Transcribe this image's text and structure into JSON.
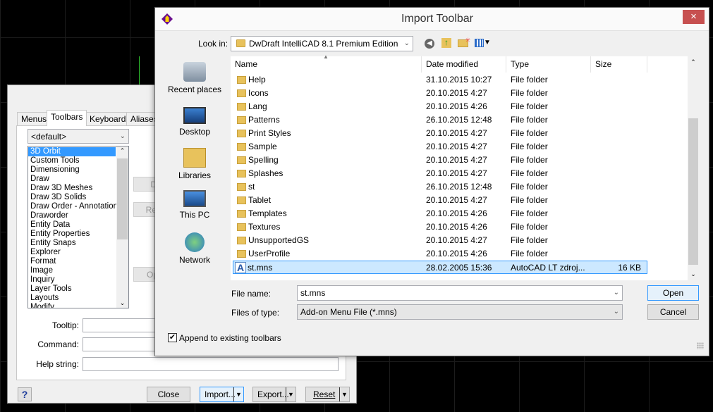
{
  "customize_dialog": {
    "tabs": [
      "Menus",
      "Toolbars",
      "Keyboard",
      "Aliases"
    ],
    "active_tab": "Toolbars",
    "toolbar_set": "<default>",
    "toolbars": [
      "3D Orbit",
      "Custom Tools",
      "Dimensioning",
      "Draw",
      "Draw 3D Meshes",
      "Draw 3D Solids",
      "Draw Order - Annotation",
      "Draworder",
      "Entity Data",
      "Entity Properties",
      "Entity Snaps",
      "Explorer",
      "Format",
      "Image",
      "Inquiry",
      "Layer Tools",
      "Layouts",
      "Modify"
    ],
    "selected_toolbar": "3D Orbit",
    "side_buttons": [
      "D",
      "Re",
      "Op"
    ],
    "tooltip_label": "Tooltip:",
    "command_label": "Command:",
    "help_label": "Help string:",
    "help_button": "?",
    "close_button": "Close",
    "import_button": "Import...",
    "export_button": "Export...",
    "reset_button": "Reset"
  },
  "import_dialog": {
    "title": "Import Toolbar",
    "close_icon": "×",
    "look_in_label": "Look in:",
    "look_in_value": "DwDraft IntelliCAD 8.1 Premium Edition",
    "places": [
      "Recent places",
      "Desktop",
      "Libraries",
      "This PC",
      "Network"
    ],
    "columns": [
      "Name",
      "Date modified",
      "Type",
      "Size"
    ],
    "files": [
      {
        "name": "Help",
        "date": "31.10.2015 10:27",
        "type": "File folder",
        "size": ""
      },
      {
        "name": "Icons",
        "date": "20.10.2015 4:27",
        "type": "File folder",
        "size": ""
      },
      {
        "name": "Lang",
        "date": "20.10.2015 4:26",
        "type": "File folder",
        "size": ""
      },
      {
        "name": "Patterns",
        "date": "26.10.2015 12:48",
        "type": "File folder",
        "size": ""
      },
      {
        "name": "Print Styles",
        "date": "20.10.2015 4:27",
        "type": "File folder",
        "size": ""
      },
      {
        "name": "Sample",
        "date": "20.10.2015 4:27",
        "type": "File folder",
        "size": ""
      },
      {
        "name": "Spelling",
        "date": "20.10.2015 4:27",
        "type": "File folder",
        "size": ""
      },
      {
        "name": "Splashes",
        "date": "20.10.2015 4:27",
        "type": "File folder",
        "size": ""
      },
      {
        "name": "st",
        "date": "26.10.2015 12:48",
        "type": "File folder",
        "size": ""
      },
      {
        "name": "Tablet",
        "date": "20.10.2015 4:27",
        "type": "File folder",
        "size": ""
      },
      {
        "name": "Templates",
        "date": "20.10.2015 4:26",
        "type": "File folder",
        "size": ""
      },
      {
        "name": "Textures",
        "date": "20.10.2015 4:26",
        "type": "File folder",
        "size": ""
      },
      {
        "name": "UnsupportedGS",
        "date": "20.10.2015 4:27",
        "type": "File folder",
        "size": ""
      },
      {
        "name": "UserProfile",
        "date": "20.10.2015 4:26",
        "type": "File folder",
        "size": ""
      },
      {
        "name": "st.mns",
        "date": "28.02.2005 15:36",
        "type": "AutoCAD LT zdroj...",
        "size": "16 KB"
      }
    ],
    "selected_file": "st.mns",
    "file_name_label": "File name:",
    "file_name_value": "st.mns",
    "file_type_label": "Files of type:",
    "file_type_value": "Add-on Menu File (*.mns)",
    "open_button": "Open",
    "cancel_button": "Cancel",
    "append_label": "Append to existing toolbars",
    "append_checked": true
  }
}
